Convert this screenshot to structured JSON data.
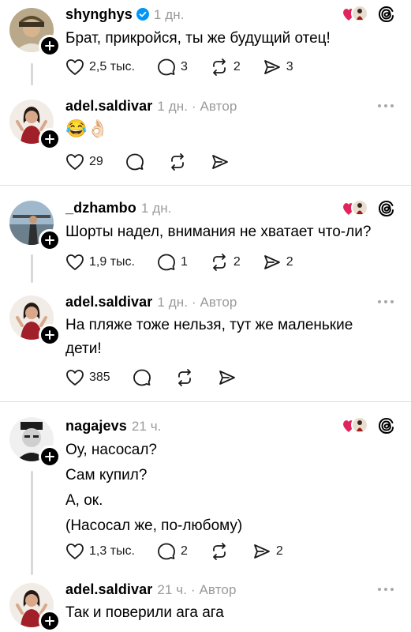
{
  "comments": [
    {
      "username": "shynghys",
      "time": "1 дн.",
      "lines": [
        "Брат, прикройся, ты же будущий отец!"
      ],
      "likes": "2,5 тыс.",
      "replies": "3",
      "reposts": "2",
      "shares": "3"
    },
    {
      "username": "adel.saldivar",
      "time": "1 дн. · Автор",
      "lines": [
        "😂👌🏻"
      ],
      "likes": "29"
    },
    {
      "username": "_dzhambo",
      "time": "1 дн.",
      "lines": [
        "Шорты надел, внимания не хватает что-ли?"
      ],
      "likes": "1,9 тыс.",
      "replies": "1",
      "reposts": "2",
      "shares": "2"
    },
    {
      "username": "adel.saldivar",
      "time": "1 дн. · Автор",
      "lines": [
        "На пляже тоже нельзя, тут же маленькие",
        "дети!"
      ],
      "likes": "385"
    },
    {
      "username": "nagajevs",
      "time": "21 ч.",
      "lines": [
        "Оу, насосал?",
        "Сам купил?",
        "А, ок.",
        "(Насосал же, по-любому)"
      ],
      "likes": "1,3 тыс.",
      "replies": "2",
      "shares": "2"
    },
    {
      "username": "adel.saldivar",
      "time": "21 ч. · Автор",
      "lines": [
        "Так и поверили ага ага"
      ]
    }
  ],
  "colors": {
    "heart": "#e0245e",
    "verified": "#0095f6",
    "muted": "#9a9a9a"
  }
}
